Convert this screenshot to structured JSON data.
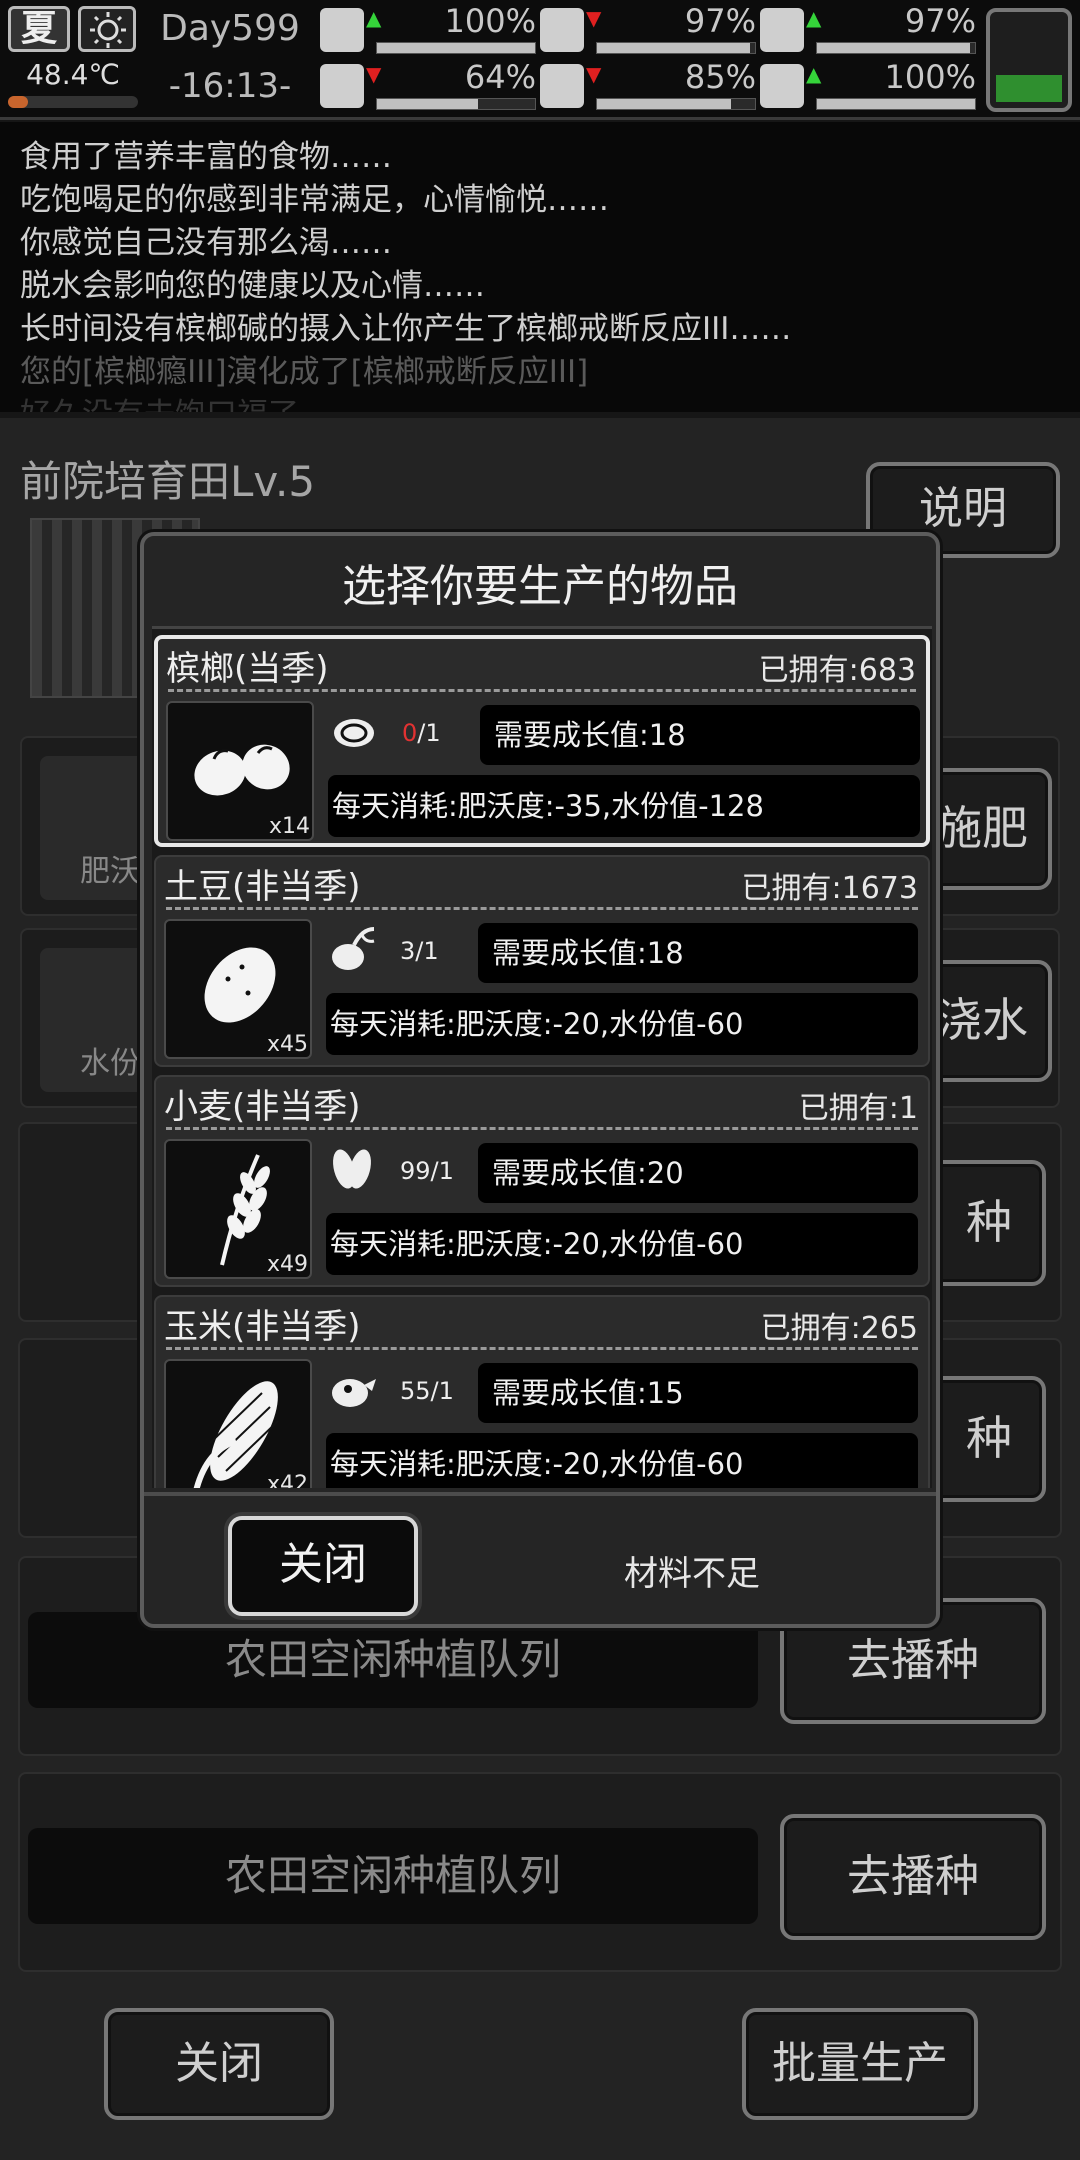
{
  "status": {
    "season": "夏",
    "temperature": "48.4℃",
    "temperature_level": 0.15,
    "day": "Day599",
    "time": "-16:13-",
    "battery_level": 0.3,
    "stats": [
      {
        "icon": "medkit-icon",
        "trend": "up",
        "value": "100%",
        "level": 1.0
      },
      {
        "icon": "stomach-icon",
        "trend": "down",
        "value": "97%",
        "level": 0.97
      },
      {
        "icon": "shield-icon",
        "trend": "up",
        "value": "97%",
        "level": 0.97
      },
      {
        "icon": "boot-icon",
        "trend": "down",
        "value": "64%",
        "level": 0.64
      },
      {
        "icon": "water-drop-icon",
        "trend": "down",
        "value": "85%",
        "level": 0.85
      },
      {
        "icon": "heart-icon",
        "trend": "up",
        "value": "100%",
        "level": 1.0
      }
    ]
  },
  "log": [
    "食用了营养丰富的食物……",
    "吃饱喝足的你感到非常满足，心情愉悦……",
    "你感觉自己没有那么渴……",
    "脱水会影响您的健康以及心情……",
    "长时间没有槟榔碱的摄入让你产生了槟榔戒断反应III……",
    "您的[槟榔瘾III]演化成了[槟榔戒断反应III]",
    "好久没有去饱口福了……"
  ],
  "farm": {
    "title": "前院培育田Lv.5",
    "help_label": "说明",
    "fertilize_label": "肥沃",
    "fertilize_button": "施肥",
    "water_label": "水份",
    "water_button": "浇水",
    "sow_partial": "种",
    "queue_label": "农田空闲种植队列",
    "queue_button": "去播种",
    "close_label": "关闭",
    "batch_label": "批量生产"
  },
  "modal": {
    "title": "选择你要生产的物品",
    "items": [
      {
        "name": "槟榔(当季)",
        "owned": "已拥有:683",
        "qty": "x14",
        "seed_have": "0",
        "seed_need": "/1",
        "growth": "需要成长值:18",
        "consume": "每天消耗:肥沃度:-35,水份值-128"
      },
      {
        "name": "土豆(非当季)",
        "owned": "已拥有:1673",
        "qty": "x45",
        "seed_have": "3",
        "seed_need": "/1",
        "growth": "需要成长值:18",
        "consume": "每天消耗:肥沃度:-20,水份值-60"
      },
      {
        "name": "小麦(非当季)",
        "owned": "已拥有:1",
        "qty": "x49",
        "seed_have": "99",
        "seed_need": "/1",
        "growth": "需要成长值:20",
        "consume": "每天消耗:肥沃度:-20,水份值-60"
      },
      {
        "name": "玉米(非当季)",
        "owned": "已拥有:265",
        "qty": "x42",
        "seed_have": "55",
        "seed_need": "/1",
        "growth": "需要成长值:15",
        "consume": "每天消耗:肥沃度:-20,水份值-60"
      }
    ],
    "close_label": "关闭",
    "shortage_label": "材料不足"
  }
}
